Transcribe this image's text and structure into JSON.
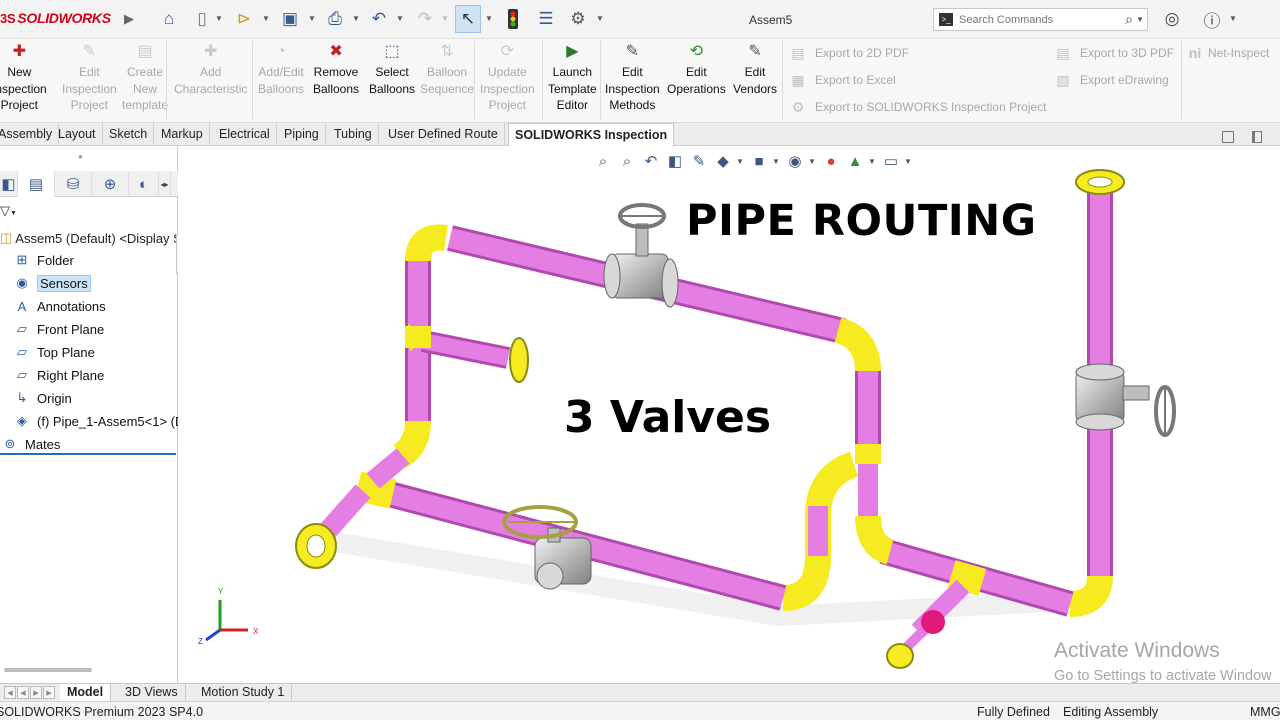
{
  "app": {
    "logo_text": "SOLIDWORKS",
    "logo_mark": "3S",
    "document_title": "Assem5",
    "accent_color": "#d0021b"
  },
  "title_toolbar": {
    "icons": [
      "home-icon",
      "new-document-icon",
      "open-icon",
      "save-icon",
      "print-icon",
      "undo-icon",
      "redo-icon",
      "select-icon",
      "rebuild-icon",
      "file-properties-icon",
      "options-icon"
    ],
    "search": {
      "placeholder": "Search Commands"
    }
  },
  "ribbon": {
    "buttons": [
      {
        "id": "new-inspection-project",
        "label": "New\nInspection\nProject",
        "enabled": true
      },
      {
        "id": "edit-inspection-project",
        "label": "Edit\nInspection\nProject",
        "enabled": false
      },
      {
        "id": "create-new-template",
        "label": "Create\nNew\ntemplate",
        "enabled": false
      },
      {
        "id": "add-characteristic",
        "label": "Add\nCharacteristic",
        "enabled": false
      },
      {
        "id": "add-edit-balloons",
        "label": "Add/Edit\nBalloons",
        "enabled": false
      },
      {
        "id": "remove-balloons",
        "label": "Remove\nBalloons",
        "enabled": true
      },
      {
        "id": "select-balloons",
        "label": "Select\nBalloons",
        "enabled": true
      },
      {
        "id": "balloon-sequence",
        "label": "Balloon\nSequence",
        "enabled": false
      },
      {
        "id": "update-inspection-project",
        "label": "Update\nInspection\nProject",
        "enabled": false
      },
      {
        "id": "launch-template-editor",
        "label": "Launch\nTemplate\nEditor",
        "enabled": true
      },
      {
        "id": "edit-inspection-methods",
        "label": "Edit\nInspection\nMethods",
        "enabled": true
      },
      {
        "id": "edit-operations",
        "label": "Edit\nOperations",
        "enabled": true
      },
      {
        "id": "edit-vendors",
        "label": "Edit\nVendors",
        "enabled": true
      }
    ],
    "exports": {
      "to_2d_pdf": "Export to 2D PDF",
      "to_excel": "Export to Excel",
      "to_inspection_project": "Export to SOLIDWORKS Inspection Project",
      "to_3d_pdf": "Export to 3D PDF",
      "to_edrawing": "Export eDrawing",
      "net_inspect": "Net-Inspect"
    }
  },
  "tabs": [
    {
      "label": "Assembly",
      "active": false
    },
    {
      "label": "Layout",
      "active": false
    },
    {
      "label": "Sketch",
      "active": false
    },
    {
      "label": "Markup",
      "active": false
    },
    {
      "label": "Electrical",
      "active": false
    },
    {
      "label": "Piping",
      "active": false
    },
    {
      "label": "Tubing",
      "active": false
    },
    {
      "label": "User Defined Route",
      "active": false
    },
    {
      "label": "SOLIDWORKS Inspection",
      "active": true
    }
  ],
  "feature_tree": {
    "root": "Assem5 (Default) <Display St",
    "items": [
      {
        "label": "Folder",
        "icon": "folder-icon",
        "selected": false
      },
      {
        "label": "Sensors",
        "icon": "sensor-icon",
        "selected": true
      },
      {
        "label": "Annotations",
        "icon": "annotations-icon",
        "selected": false
      },
      {
        "label": "Front Plane",
        "icon": "plane-icon",
        "selected": false
      },
      {
        "label": "Top Plane",
        "icon": "plane-icon",
        "selected": false
      },
      {
        "label": "Right Plane",
        "icon": "plane-icon",
        "selected": false
      },
      {
        "label": "Origin",
        "icon": "origin-icon",
        "selected": false
      },
      {
        "label": "(f) Pipe_1-Assem5<1> (D",
        "icon": "part-icon",
        "selected": false
      },
      {
        "label": "Mates",
        "icon": "mates-icon",
        "selected": false
      }
    ]
  },
  "viewport": {
    "overlay_title": "PIPE ROUTING",
    "overlay_subtitle": "3 Valves",
    "watermark_line1": "Activate Windows",
    "watermark_line2": "Go to Settings to activate Window",
    "pipe_color": "#e57ee3",
    "fitting_color": "#f6ea20",
    "valve_color": "#c8c8c8",
    "triad_labels": {
      "x": "X",
      "y": "Y",
      "z": "Z"
    }
  },
  "bottom_tabs": [
    {
      "label": "Model",
      "active": true
    },
    {
      "label": "3D Views",
      "active": false
    },
    {
      "label": "Motion Study 1",
      "active": false
    }
  ],
  "status": {
    "product": "SOLIDWORKS Premium 2023 SP4.0",
    "state": "Fully Defined",
    "mode": "Editing Assembly",
    "units": "MMGS"
  }
}
